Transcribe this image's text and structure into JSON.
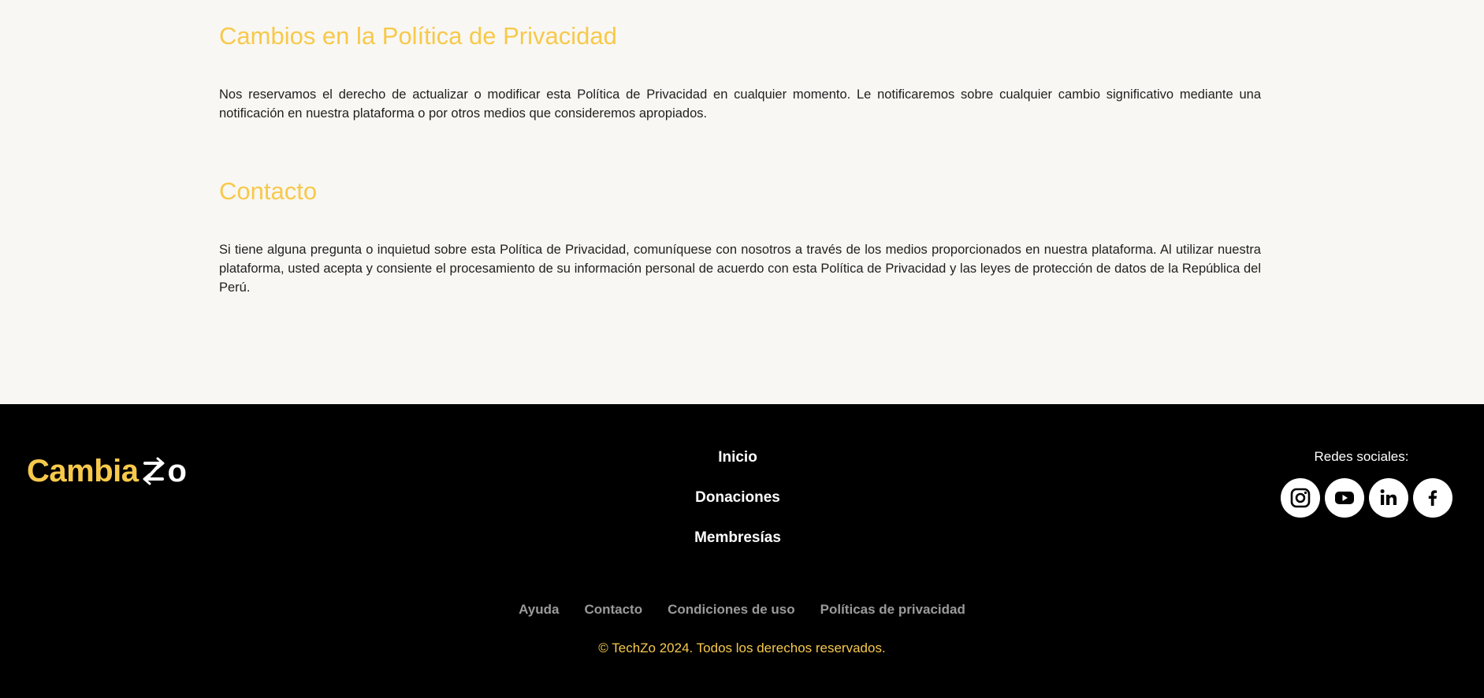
{
  "sections": [
    {
      "title": "Cambios en la Política de Privacidad",
      "body": "Nos reservamos el derecho de actualizar o modificar esta Política de Privacidad en cualquier momento. Le notificaremos sobre cualquier cambio significativo mediante una notificación en nuestra plataforma o por otros medios que consideremos apropiados."
    },
    {
      "title": "Contacto",
      "body": "Si tiene alguna pregunta o inquietud sobre esta Política de Privacidad, comuníquese con nosotros a través de los medios proporcionados en nuestra plataforma. Al utilizar nuestra plataforma, usted acepta y consiente el procesamiento de su información personal de acuerdo con esta Política de Privacidad y las leyes de protección de datos de la República del Perú."
    }
  ],
  "footer": {
    "logo": {
      "text_main": "Cambia",
      "text_end": "o"
    },
    "nav": [
      "Inicio",
      "Donaciones",
      "Membresías"
    ],
    "social_label": "Redes sociales:",
    "social_icons": [
      "instagram-icon",
      "youtube-icon",
      "linkedin-icon",
      "facebook-icon"
    ],
    "bottom_links": [
      "Ayuda",
      "Contacto",
      "Condiciones de uso",
      "Políticas de privacidad"
    ],
    "copyright": "© TechZo 2024. Todos los derechos reservados."
  },
  "colors": {
    "accent": "#f7c94b",
    "page_bg": "#f8f7f3",
    "footer_bg": "#000000",
    "muted_link": "#9a9a9a"
  }
}
